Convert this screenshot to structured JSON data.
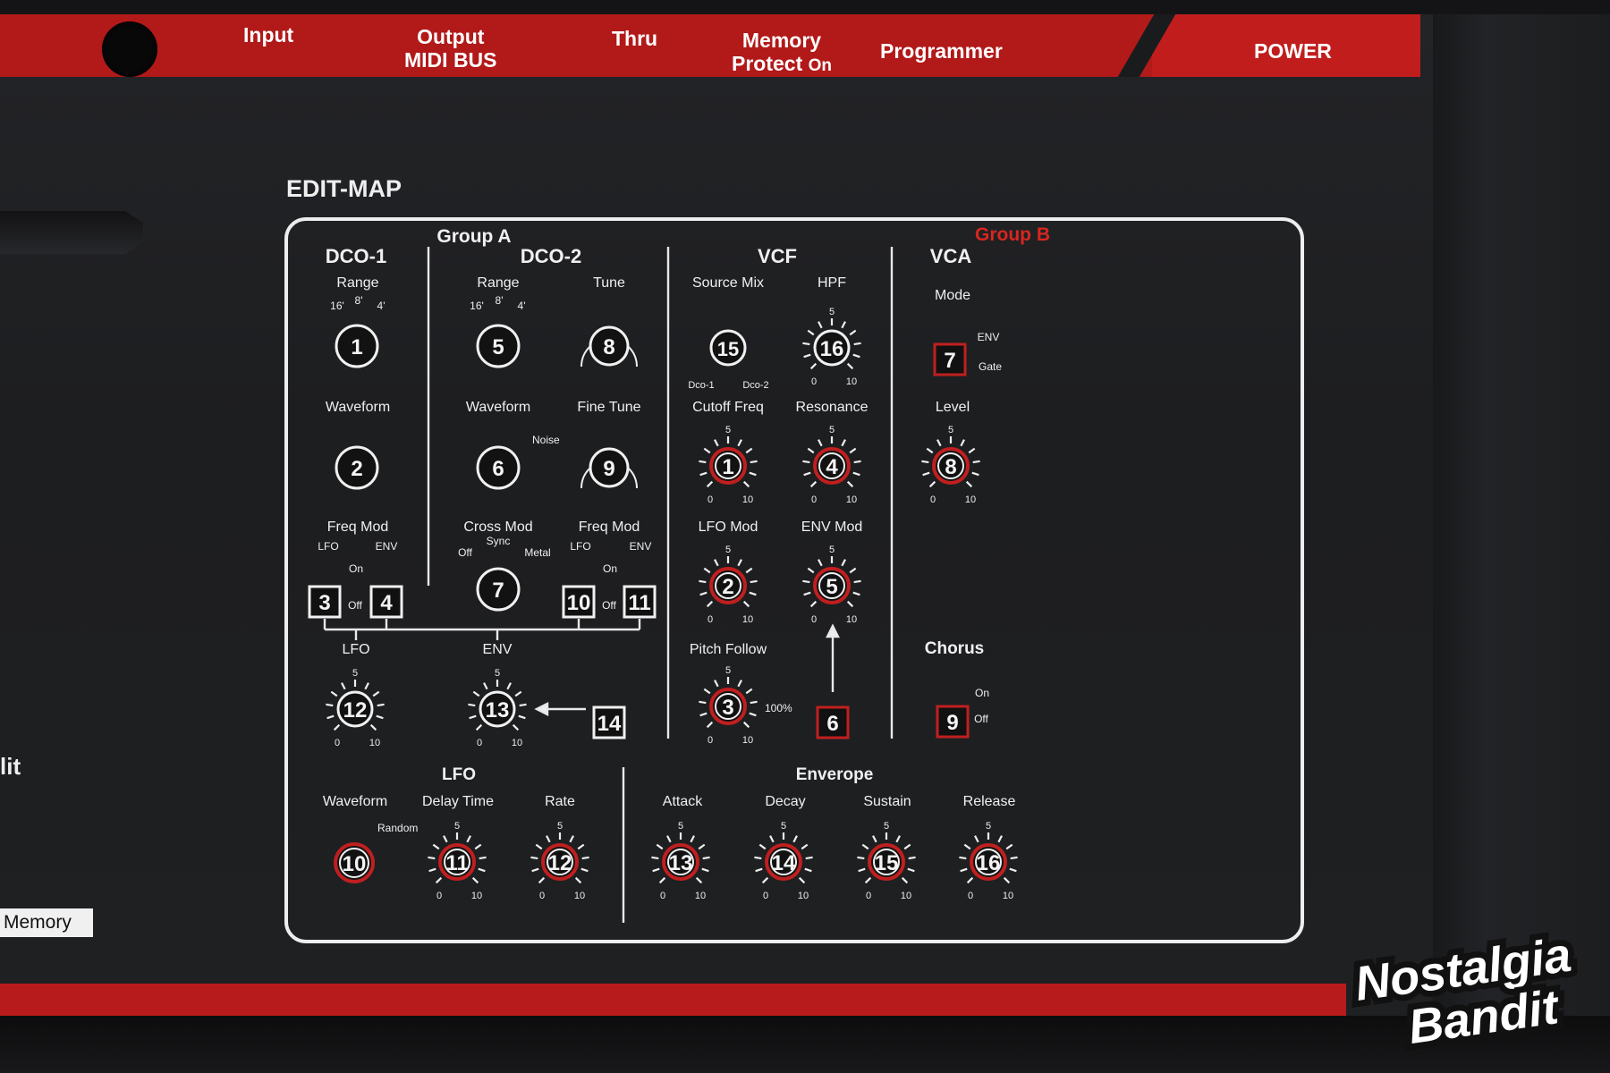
{
  "top_strip": {
    "input": "Input",
    "output_line1": "Output",
    "output_line2": "MIDI BUS",
    "thru": "Thru",
    "memory_line1": "Memory",
    "memory_line2": "Protect",
    "memory_on": "On",
    "programmer": "Programmer",
    "power": "POWER"
  },
  "side": {
    "edit_fragment": "lit",
    "memory_button": "Memory"
  },
  "edit_map": {
    "title": "EDIT-MAP",
    "group_a": "Group A",
    "group_b": "Group B",
    "dco1": {
      "title": "DCO-1",
      "range_label": "Range",
      "range_marks": [
        "16'",
        "8'",
        "4'"
      ],
      "range_num": "1",
      "waveform_label": "Waveform",
      "waveform_num": "2",
      "freq_mod_label": "Freq  Mod",
      "lfo": "LFO",
      "env": "ENV",
      "on": "On",
      "off": "Off",
      "btn_lfo": "3",
      "btn_env": "4"
    },
    "dco2": {
      "title": "DCO-2",
      "range_label": "Range",
      "range_marks": [
        "16'",
        "8'",
        "4'"
      ],
      "range_num": "5",
      "tune_label": "Tune",
      "tune_num": "8",
      "waveform_label": "Waveform",
      "noise": "Noise",
      "waveform_num": "6",
      "fine_tune_label": "Fine Tune",
      "fine_tune_num": "9",
      "cross_mod_label": "Cross Mod",
      "sync": "Sync",
      "off": "Off",
      "metal": "Metal",
      "cross_mod_num": "7",
      "freq_mod_label": "Freq  Mod",
      "lfo": "LFO",
      "env": "ENV",
      "on": "On",
      "off2": "Off",
      "btn_lfo": "10",
      "btn_env": "11"
    },
    "mod_sources": {
      "lfo_label": "LFO",
      "lfo_num": "12",
      "env_label": "ENV",
      "env_num": "13",
      "env_btn": "14"
    },
    "vcf": {
      "title": "VCF",
      "source_mix_label": "Source  Mix",
      "source_mix_num": "15",
      "dco1": "Dco-1",
      "dco2": "Dco-2",
      "hpf_label": "HPF",
      "hpf_num": "16",
      "cutoff_label": "Cutoff Freq",
      "cutoff_num": "1",
      "resonance_label": "Resonance",
      "resonance_num": "4",
      "lfo_mod_label": "LFO Mod",
      "lfo_mod_num": "2",
      "env_mod_label": "ENV  Mod",
      "env_mod_num": "5",
      "pitch_follow_label": "Pitch  Follow",
      "pitch_follow_num": "3",
      "pitch_follow_max": "100%",
      "env_btn": "6"
    },
    "vca": {
      "title": "VCA",
      "mode_label": "Mode",
      "mode_btn": "7",
      "env": "ENV",
      "gate": "Gate",
      "level_label": "Level",
      "level_num": "8",
      "chorus_label": "Chorus",
      "chorus_btn": "9",
      "on": "On",
      "off": "Off"
    },
    "lfo": {
      "title": "LFO",
      "waveform_label": "Waveform",
      "random": "Random",
      "waveform_num": "10",
      "delay_label": "Delay Time",
      "delay_num": "11",
      "rate_label": "Rate",
      "rate_num": "12"
    },
    "envelope": {
      "title": "Enverope",
      "attack_label": "Attack",
      "attack_num": "13",
      "decay_label": "Decay",
      "decay_num": "14",
      "sustain_label": "Sustain",
      "sustain_num": "15",
      "release_label": "Release",
      "release_num": "16"
    },
    "scale": {
      "min": "0",
      "mid": "5",
      "max": "10"
    }
  },
  "watermark": {
    "line1": "Nostalgia",
    "line2": "Bandit"
  },
  "colors": {
    "panel_red": "#b31a1a",
    "knob_red": "#c01f1f",
    "group_b": "#d8261f",
    "white": "#f0f0f0"
  }
}
